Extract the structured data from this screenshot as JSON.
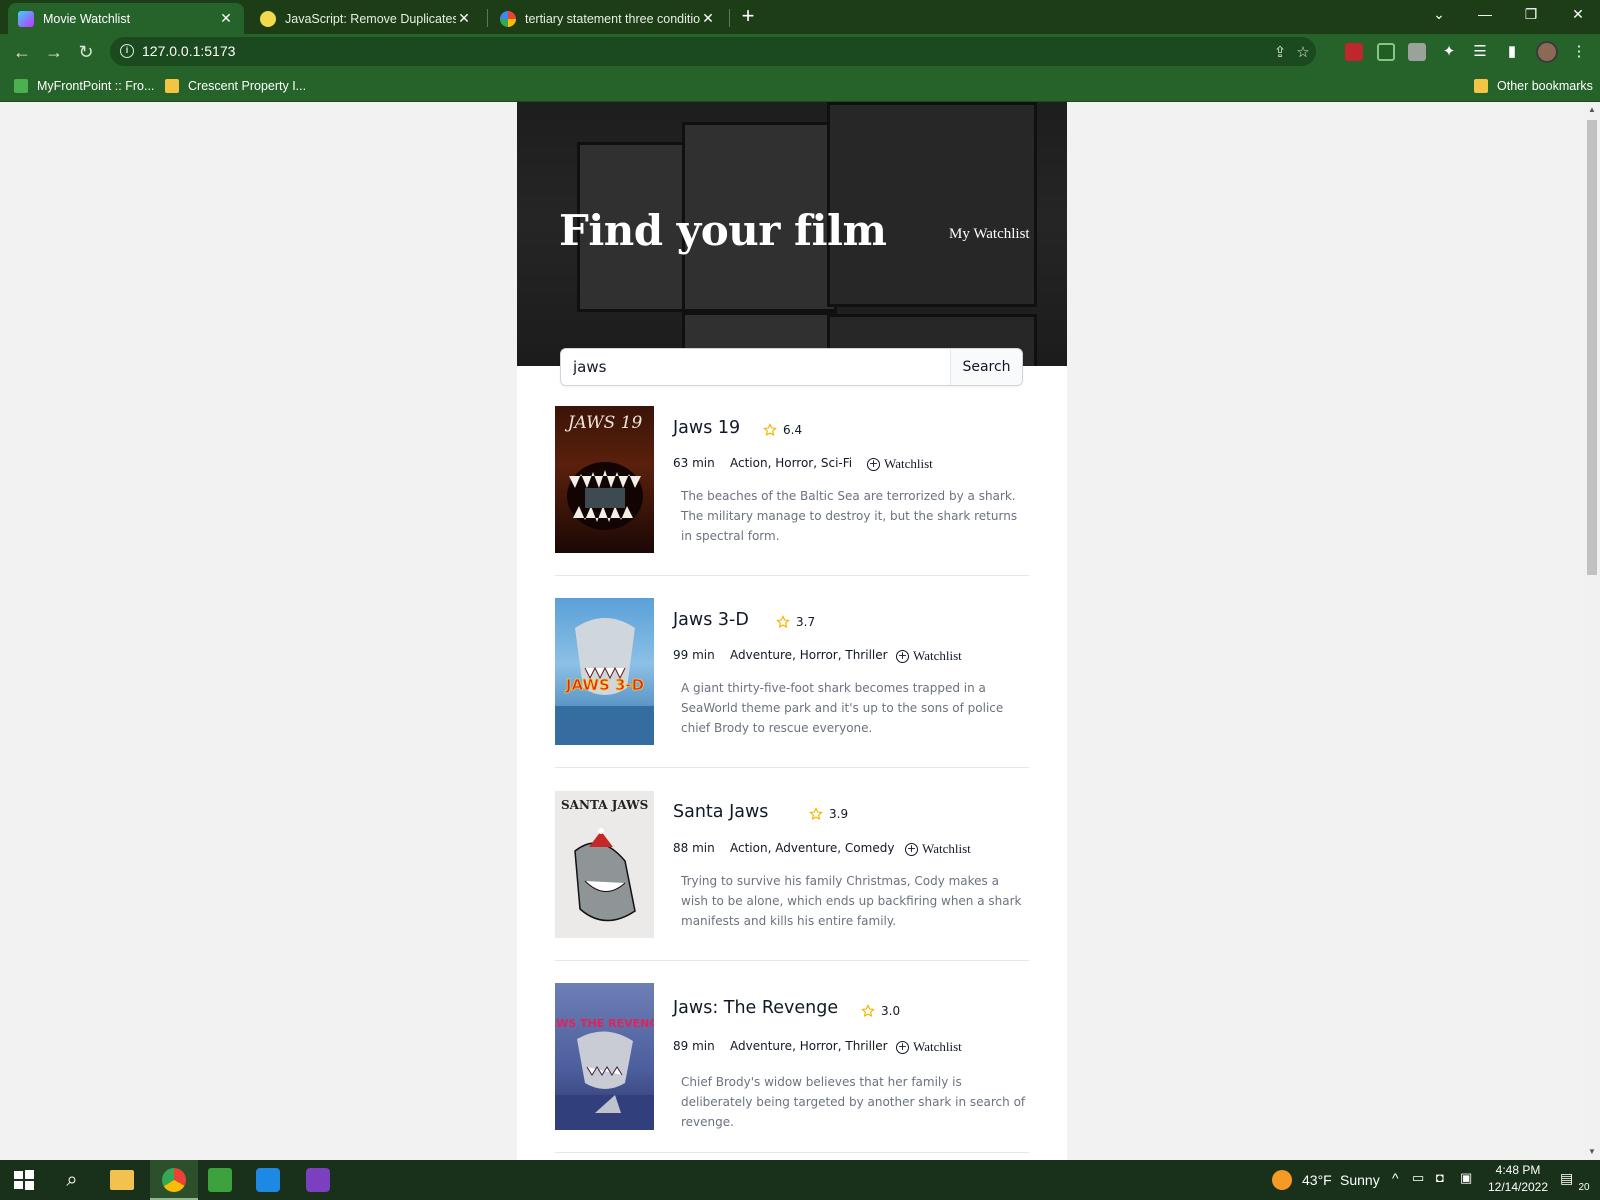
{
  "browser": {
    "tabs": [
      {
        "title": "Movie Watchlist",
        "active": true
      },
      {
        "title": "JavaScript: Remove Duplicates fr",
        "active": false
      },
      {
        "title": "tertiary statement three condition",
        "active": false
      }
    ],
    "url": "127.0.0.1:5173",
    "bookmarks": [
      "MyFrontPoint :: Fro...",
      "Crescent Property I..."
    ],
    "other_bookmarks": "Other bookmarks",
    "theme_colors": {
      "tabstrip": "#1d3d17",
      "toolbar": "#25632a"
    }
  },
  "app": {
    "hero_title": "Find your film",
    "watchlist_link": "My Watchlist",
    "search": {
      "value": "jaws",
      "button_label": "Search"
    },
    "watchlist_button_label": "Watchlist",
    "star_color": "#f5b301",
    "movies": [
      {
        "title": "Jaws 19",
        "rating": "6.4",
        "runtime": "63 min",
        "genres": "Action, Horror, Sci-Fi",
        "plot": "The beaches of the Baltic Sea are terrorized by a shark. The military manage to destroy it, but the shark returns in spectral form.",
        "poster_text": "JAWS 19"
      },
      {
        "title": "Jaws 3-D",
        "rating": "3.7",
        "runtime": "99 min",
        "genres": "Adventure, Horror, Thriller",
        "plot": "A giant thirty-five-foot shark becomes trapped in a SeaWorld theme park and it's up to the sons of police chief Brody to rescue everyone.",
        "poster_text": "JAWS 3-D"
      },
      {
        "title": "Santa Jaws",
        "rating": "3.9",
        "runtime": "88 min",
        "genres": "Action, Adventure, Comedy",
        "plot": "Trying to survive his family Christmas, Cody makes a wish to be alone, which ends up backfiring when a shark manifests and kills his entire family.",
        "poster_text": "SANTA JAWS"
      },
      {
        "title": "Jaws: The Revenge",
        "rating": "3.0",
        "runtime": "89 min",
        "genres": "Adventure, Horror, Thriller",
        "plot": "Chief Brody's widow believes that her family is deliberately being targeted by another shark in search of revenge.",
        "poster_text": "JAWS THE REVENGE"
      }
    ]
  },
  "taskbar": {
    "weather_temp": "43°F",
    "weather_text": "Sunny",
    "time": "4:48 PM",
    "date": "12/14/2022",
    "notification_count": "20"
  }
}
